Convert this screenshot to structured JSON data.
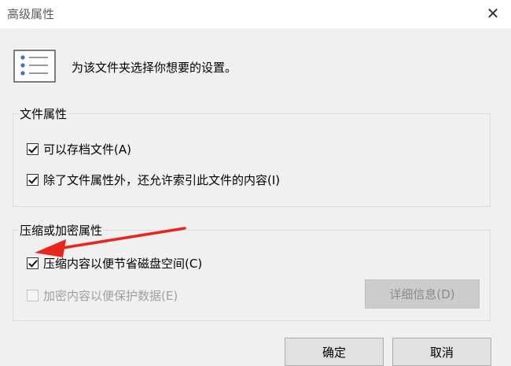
{
  "window": {
    "title": "高级属性",
    "close_glyph": "✕"
  },
  "header": {
    "icon": "settings-list-icon",
    "text": "为该文件夹选择你想要的设置。"
  },
  "file_attributes": {
    "title": "文件属性",
    "archive": {
      "label": "可以存档文件(A)",
      "checked": true
    },
    "index": {
      "label": "除了文件属性外，还允许索引此文件的内容(I)",
      "checked": true
    }
  },
  "compress_encrypt": {
    "title": "压缩或加密属性",
    "compress": {
      "label": "压缩内容以便节省磁盘空间(C)",
      "checked": true
    },
    "encrypt": {
      "label": "加密内容以便保护数据(E)",
      "checked": false,
      "disabled": true
    },
    "details_button": "详细信息(D)"
  },
  "footer": {
    "ok": "确定",
    "cancel": "取消"
  },
  "colors": {
    "annotation_arrow": "#e8261c",
    "icon_blue": "#3b6fd1"
  }
}
